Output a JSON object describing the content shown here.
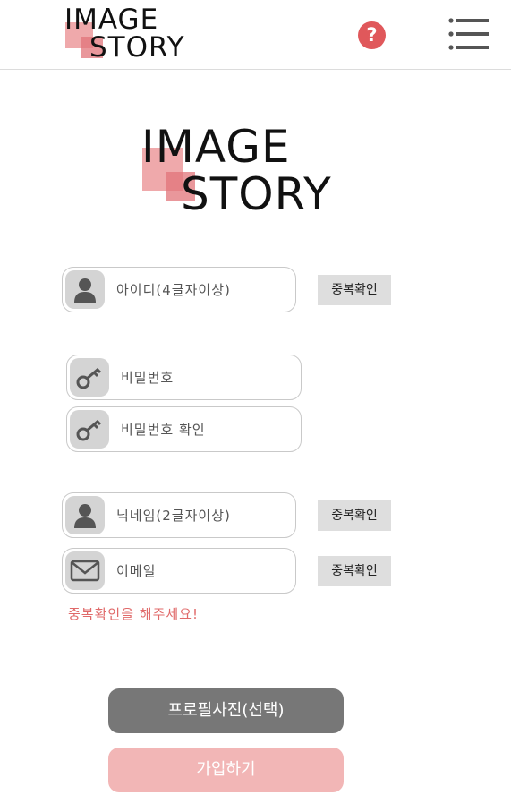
{
  "header": {
    "logo_line1": "IMAGE",
    "logo_line2": "STORY",
    "help_label": "?",
    "help_icon": "question-circle-icon",
    "menu_icon": "hamburger-menu-icon"
  },
  "hero": {
    "logo_line1": "IMAGE",
    "logo_line2": "STORY"
  },
  "form": {
    "id_placeholder": "아이디(4글자이상)",
    "id_check_label": "중복확인",
    "password_placeholder": "비밀번호",
    "password_confirm_placeholder": "비밀번호 확인",
    "nickname_placeholder": "닉네임(2글자이상)",
    "nickname_check_label": "중복확인",
    "email_placeholder": "이메일",
    "email_check_label": "중복확인",
    "warning_text": "중복확인을 해주세요!",
    "profile_photo_label": "프로필사진(선택)",
    "join_label": "가입하기"
  },
  "icons": {
    "user": "user-icon",
    "key": "key-icon",
    "mail": "mail-icon"
  },
  "colors": {
    "logo_pink": "#e98c8f",
    "help_red": "#e0585b",
    "warning_red": "#e06a6a",
    "profile_gray": "#777777",
    "join_pink": "#f2b6b6",
    "field_icon_bg": "#d4d4d4",
    "dup_btn_bg": "#dedede"
  }
}
